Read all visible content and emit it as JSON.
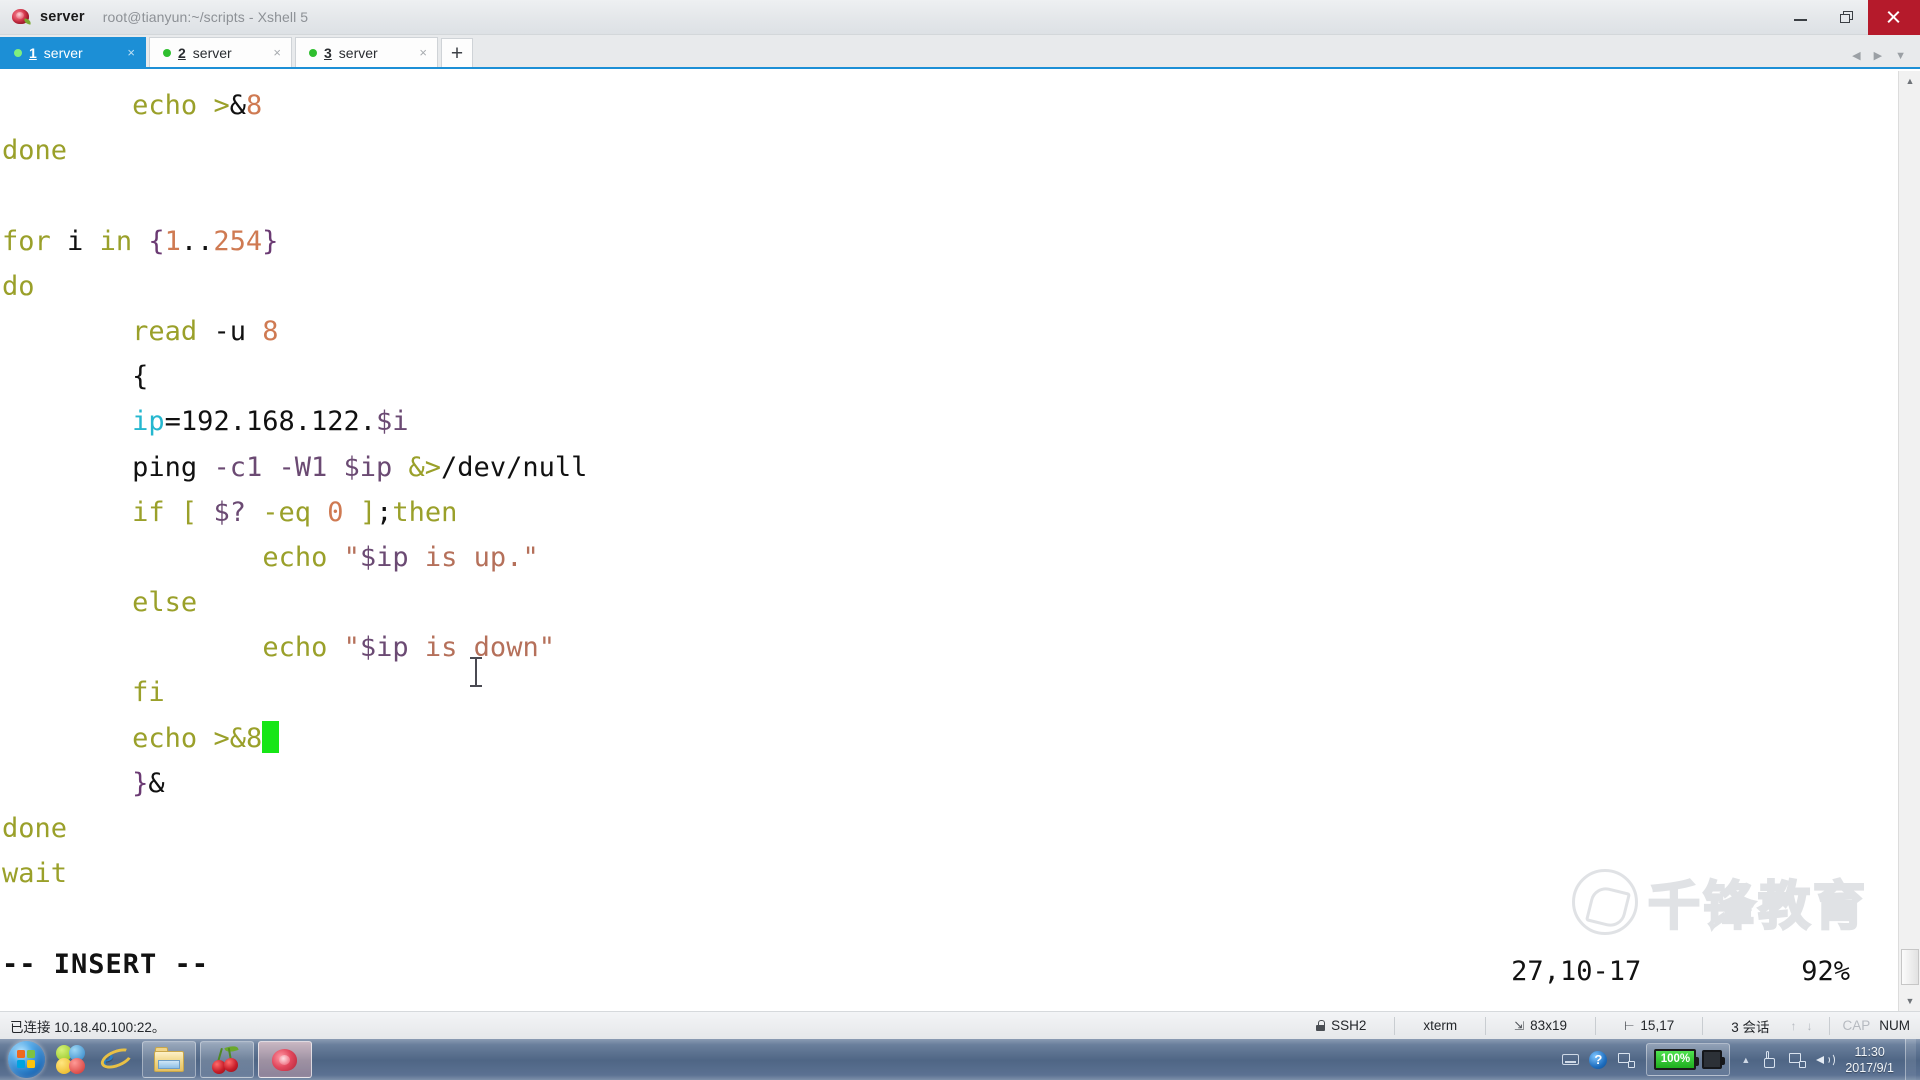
{
  "window": {
    "app_name": "server",
    "title": "root@tianyun:~/scripts - Xshell 5",
    "minimize_label": "Minimize",
    "restore_label": "Restore",
    "close_label": "Close"
  },
  "tabs": {
    "items": [
      {
        "num": "1",
        "label": "server",
        "close": "×",
        "active": true
      },
      {
        "num": "2",
        "label": "server",
        "close": "×",
        "active": false
      },
      {
        "num": "3",
        "label": "server",
        "close": "×",
        "active": false
      }
    ],
    "add_label": "+",
    "nav_prev": "◀",
    "nav_next": "▶",
    "nav_menu": "▼"
  },
  "terminal": {
    "lines": [
      {
        "indent": 8,
        "tokens": [
          {
            "t": "echo ",
            "c": "k"
          },
          {
            "t": ">",
            "c": "k"
          },
          {
            "t": "&",
            "c": "pl"
          },
          {
            "t": "8",
            "c": "nu"
          }
        ]
      },
      {
        "indent": 0,
        "tokens": [
          {
            "t": "done",
            "c": "k"
          }
        ]
      },
      {
        "indent": 0,
        "tokens": [
          {
            "t": "",
            "c": "pl"
          }
        ]
      },
      {
        "indent": 0,
        "tokens": [
          {
            "t": "for",
            "c": "k"
          },
          {
            "t": " i ",
            "c": "pl"
          },
          {
            "t": "in",
            "c": "k"
          },
          {
            "t": " ",
            "c": "pl"
          },
          {
            "t": "{",
            "c": "br"
          },
          {
            "t": "1",
            "c": "nu"
          },
          {
            "t": "..",
            "c": "pl"
          },
          {
            "t": "254",
            "c": "nu"
          },
          {
            "t": "}",
            "c": "br"
          }
        ]
      },
      {
        "indent": 0,
        "tokens": [
          {
            "t": "do",
            "c": "k"
          }
        ]
      },
      {
        "indent": 8,
        "tokens": [
          {
            "t": "read",
            "c": "k"
          },
          {
            "t": " -u ",
            "c": "pl"
          },
          {
            "t": "8",
            "c": "nu"
          }
        ]
      },
      {
        "indent": 8,
        "tokens": [
          {
            "t": "{",
            "c": "pl"
          }
        ]
      },
      {
        "indent": 8,
        "tokens": [
          {
            "t": "ip",
            "c": "cy"
          },
          {
            "t": "=192.168.122.",
            "c": "pl"
          },
          {
            "t": "$i",
            "c": "va"
          }
        ]
      },
      {
        "indent": 8,
        "tokens": [
          {
            "t": "ping ",
            "c": "pl"
          },
          {
            "t": "-c1 -W1 ",
            "c": "va"
          },
          {
            "t": "$ip",
            "c": "va"
          },
          {
            "t": " ",
            "c": "pl"
          },
          {
            "t": "&>",
            "c": "k"
          },
          {
            "t": "/dev/null",
            "c": "pl"
          }
        ]
      },
      {
        "indent": 8,
        "tokens": [
          {
            "t": "if",
            "c": "k"
          },
          {
            "t": " [ ",
            "c": "k"
          },
          {
            "t": "$?",
            "c": "va"
          },
          {
            "t": " ",
            "c": "pl"
          },
          {
            "t": "-eq",
            "c": "k"
          },
          {
            "t": " ",
            "c": "pl"
          },
          {
            "t": "0",
            "c": "nu"
          },
          {
            "t": " ",
            "c": "pl"
          },
          {
            "t": "]",
            "c": "k"
          },
          {
            "t": ";",
            "c": "pl"
          },
          {
            "t": "then",
            "c": "k"
          }
        ]
      },
      {
        "indent": 16,
        "tokens": [
          {
            "t": "echo",
            "c": "k"
          },
          {
            "t": " ",
            "c": "pl"
          },
          {
            "t": "\"",
            "c": "st"
          },
          {
            "t": "$ip",
            "c": "va"
          },
          {
            "t": " is up.\"",
            "c": "st"
          }
        ]
      },
      {
        "indent": 8,
        "tokens": [
          {
            "t": "else",
            "c": "k"
          }
        ]
      },
      {
        "indent": 16,
        "tokens": [
          {
            "t": "echo",
            "c": "k"
          },
          {
            "t": " ",
            "c": "pl"
          },
          {
            "t": "\"",
            "c": "st"
          },
          {
            "t": "$ip",
            "c": "va"
          },
          {
            "t": " is down\"",
            "c": "st"
          }
        ]
      },
      {
        "indent": 8,
        "tokens": [
          {
            "t": "fi",
            "c": "k"
          }
        ]
      },
      {
        "indent": 8,
        "tokens": [
          {
            "t": "echo ",
            "c": "k"
          },
          {
            "t": ">",
            "c": "k"
          },
          {
            "t": "&",
            "c": "k"
          },
          {
            "t": "8",
            "c": "k"
          }
        ],
        "cursor": true
      },
      {
        "indent": 8,
        "tokens": [
          {
            "t": "}",
            "c": "br"
          },
          {
            "t": "&",
            "c": "pl"
          }
        ]
      },
      {
        "indent": 0,
        "tokens": [
          {
            "t": "done",
            "c": "k"
          }
        ]
      },
      {
        "indent": 0,
        "tokens": [
          {
            "t": "wait",
            "c": "k"
          }
        ]
      }
    ],
    "mode_line": "-- INSERT --",
    "cursor_position": "27,10-17",
    "file_percent": "92%",
    "watermark_text": "千锋教育"
  },
  "statusbar": {
    "connection": "已连接 10.18.40.100:22。",
    "protocol": "SSH2",
    "terminal_type": "xterm",
    "size": "83x19",
    "cursor": "15,17",
    "sessions": "3 会话",
    "arrow_up": "↑",
    "arrow_down": "↓",
    "cap": "CAP",
    "num": "NUM"
  },
  "taskbar": {
    "start_label": "Start",
    "items": [
      {
        "name": "media-balls",
        "label": "Media Player"
      },
      {
        "name": "internet-explorer",
        "label": "Internet Explorer"
      },
      {
        "name": "file-explorer",
        "label": "Windows Explorer"
      },
      {
        "name": "cherry-app",
        "label": "CherryTree"
      },
      {
        "name": "xshell",
        "label": "Xshell 5"
      }
    ],
    "tray": {
      "battery_level": "100%",
      "help": "?",
      "show_hidden": "▲"
    },
    "clock_time": "11:30",
    "clock_date": "2017/9/1"
  },
  "colors": {
    "accent_blue": "#1c8fd6",
    "close_red": "#b51a2b",
    "keyword_olive": "#9aa02a",
    "number_salmon": "#cf7a52",
    "variable_purple": "#6b4a73",
    "string_brown": "#b5705a",
    "cyan": "#25b7cf",
    "cursor_green": "#16e616"
  }
}
